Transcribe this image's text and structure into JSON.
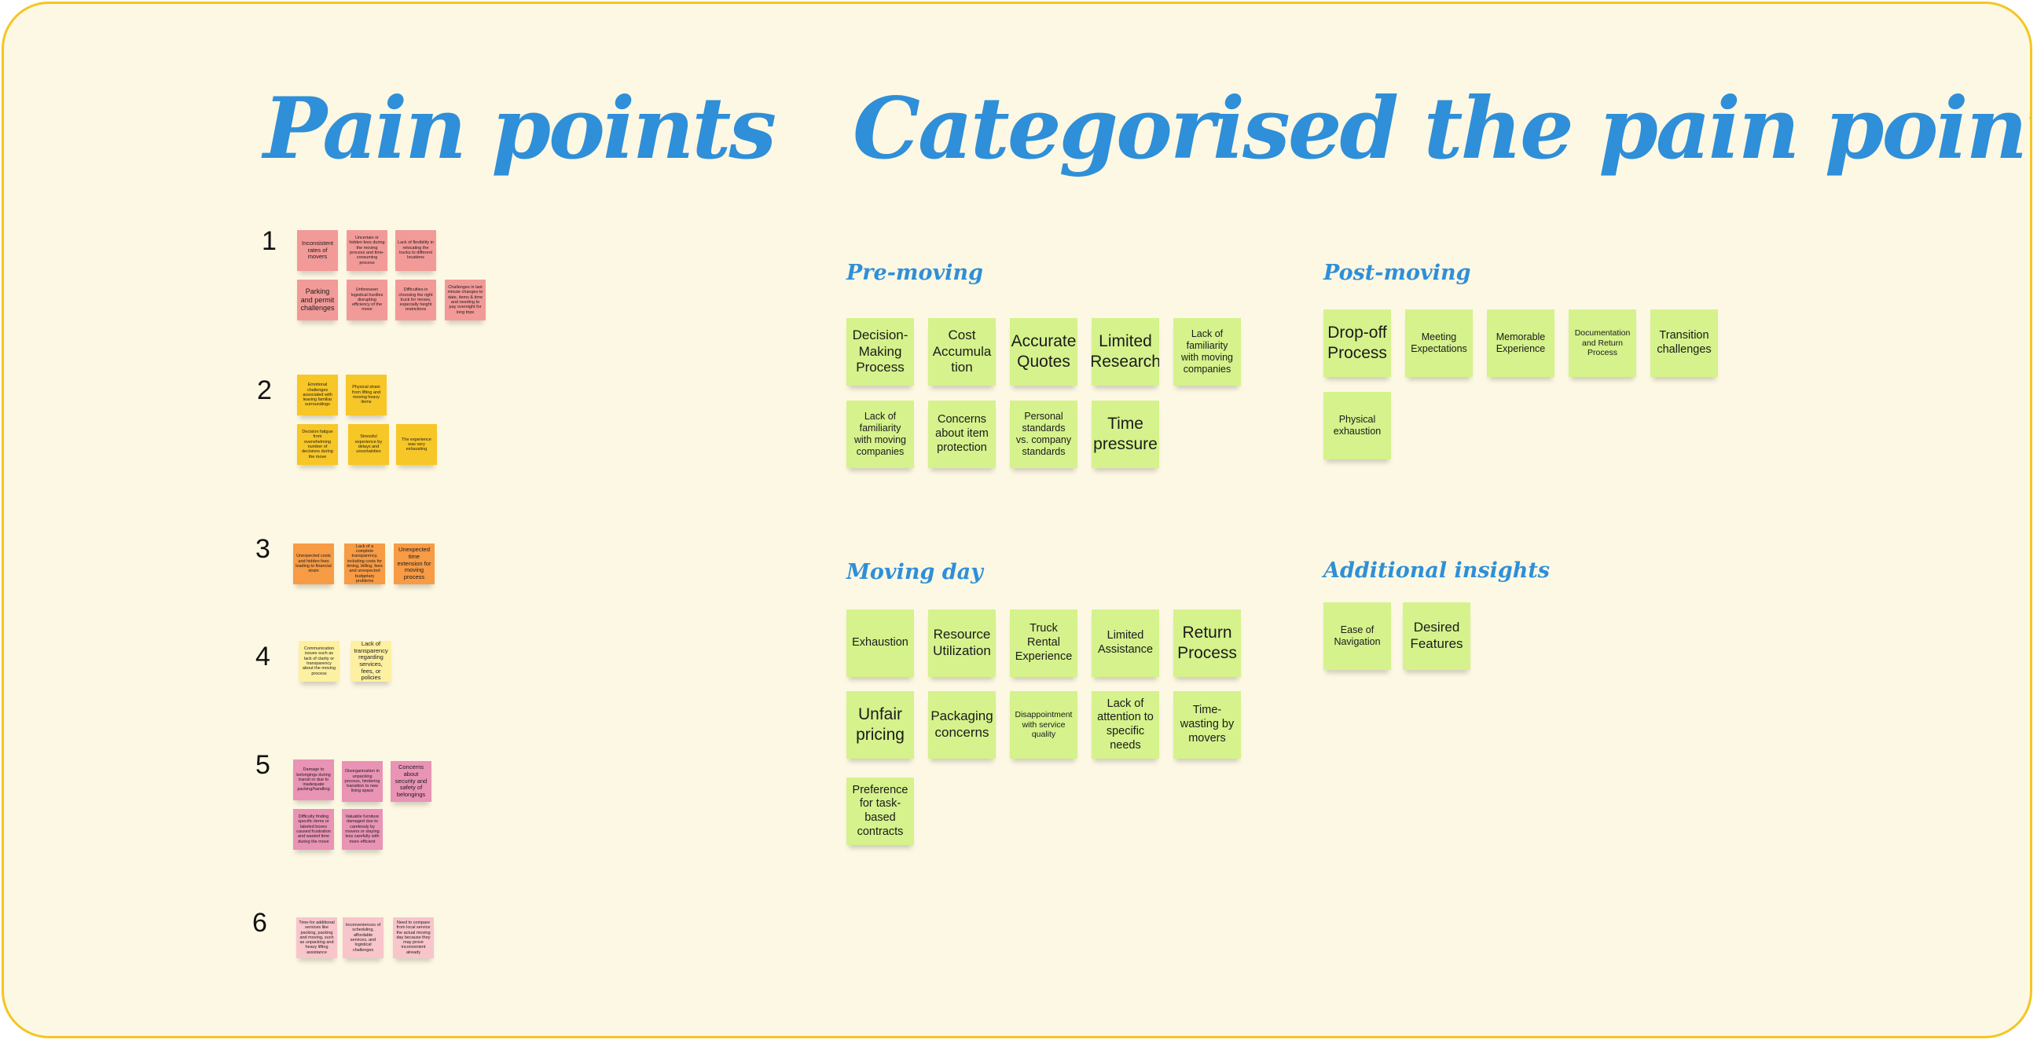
{
  "titles": {
    "pain_points": "Pain points",
    "categorised": "Categorised the pain points"
  },
  "rows": [
    {
      "number": "1",
      "color": "#f29a98",
      "notes": [
        "Inconsistent rates of movers",
        "Uncertain or hidden fees during the moving process and time-consuming process",
        "Lack of flexibility in relocating the trucks to different locations",
        "Parking and permit challenges",
        "Unforeseen logistical hurdles disrupting efficiency of the move",
        "Difficulties in choosing the right truck for moves, especially height restrictions",
        "Challenges in last minute changes to date, items & time and needing to pay overnight for long trips"
      ]
    },
    {
      "number": "2",
      "color": "#f7c627",
      "notes": [
        "Emotional challenges associated with leaving familiar surroundings",
        "Physical strain from lifting and moving heavy items",
        "Decision fatigue from overwhelming number of decisions during the move",
        "Stressful experience by delays and uncertainties",
        "The experience was very exhausting"
      ]
    },
    {
      "number": "3",
      "color": "#f79b45",
      "notes": [
        "Unexpected costs and hidden fees leading to financial strain",
        "Lack of a complete transparency, including costs for timing, billing, fees and unexpected budgetary problems",
        "Unexpected time extension for moving process"
      ]
    },
    {
      "number": "4",
      "color": "#fdf0a0",
      "notes": [
        "Communication issues such as lack of clarity or transparency about the moving process",
        "Lack of transparency regarding services, fees, or policies"
      ]
    },
    {
      "number": "5",
      "color": "#e993b5",
      "notes": [
        "Damage to belongings during transit or due to inadequate packing/handling",
        "Disorganization in unpacking process, hindering transition to new living space",
        "Concerns about security and safety of belongings",
        "Difficulty finding specific items or labeled boxes caused frustration and wasted time during the move",
        "Valuable furniture damaged due to carelessly by movers or staying less carefully with more efficient"
      ]
    },
    {
      "number": "6",
      "color": "#f8c5cb",
      "notes": [
        "Time-for additional services like packing, packing and moving, such as unpacking and heavy lifting assistance",
        "Inconveniences of scheduling, affordable services, and logistical challenges",
        "Need to compare from local service the actual moving day because they may prove inconvenient already"
      ]
    }
  ],
  "categories": {
    "pre_moving": {
      "heading": "Pre-moving",
      "notes": [
        "Decision-Making Process",
        "Cost Accumula tion",
        "Accurate Quotes",
        "Limited Research",
        "Lack of familiarity with moving companies",
        "Lack of familiarity with moving companies",
        "Concerns about item protection",
        "Personal standards vs. company standards",
        "Time pressure"
      ]
    },
    "post_moving": {
      "heading": "Post-moving",
      "notes": [
        "Drop-off Process",
        "Meeting Expectations",
        "Memorable Experience",
        "Documentation and Return Process",
        "Transition challenges",
        "Physical exhaustion"
      ]
    },
    "moving_day": {
      "heading": "Moving day",
      "notes": [
        "Exhaustion",
        "Resource Utilization",
        "Truck Rental Experience",
        "Limited Assistance",
        "Return Process",
        "Unfair pricing",
        "Packaging concerns",
        "Disappointment with service quality",
        "Lack of attention to specific needs",
        "Time-wasting by movers",
        "Preference for task-based contracts"
      ]
    },
    "additional": {
      "heading": "Additional insights",
      "notes": [
        "Ease of Navigation",
        "Desired Features"
      ]
    }
  },
  "colors": {
    "board_background": "#fdf8e3",
    "board_border": "#f3c623",
    "title_blue": "#2f8fd8",
    "category_note": "#d5f28c"
  }
}
